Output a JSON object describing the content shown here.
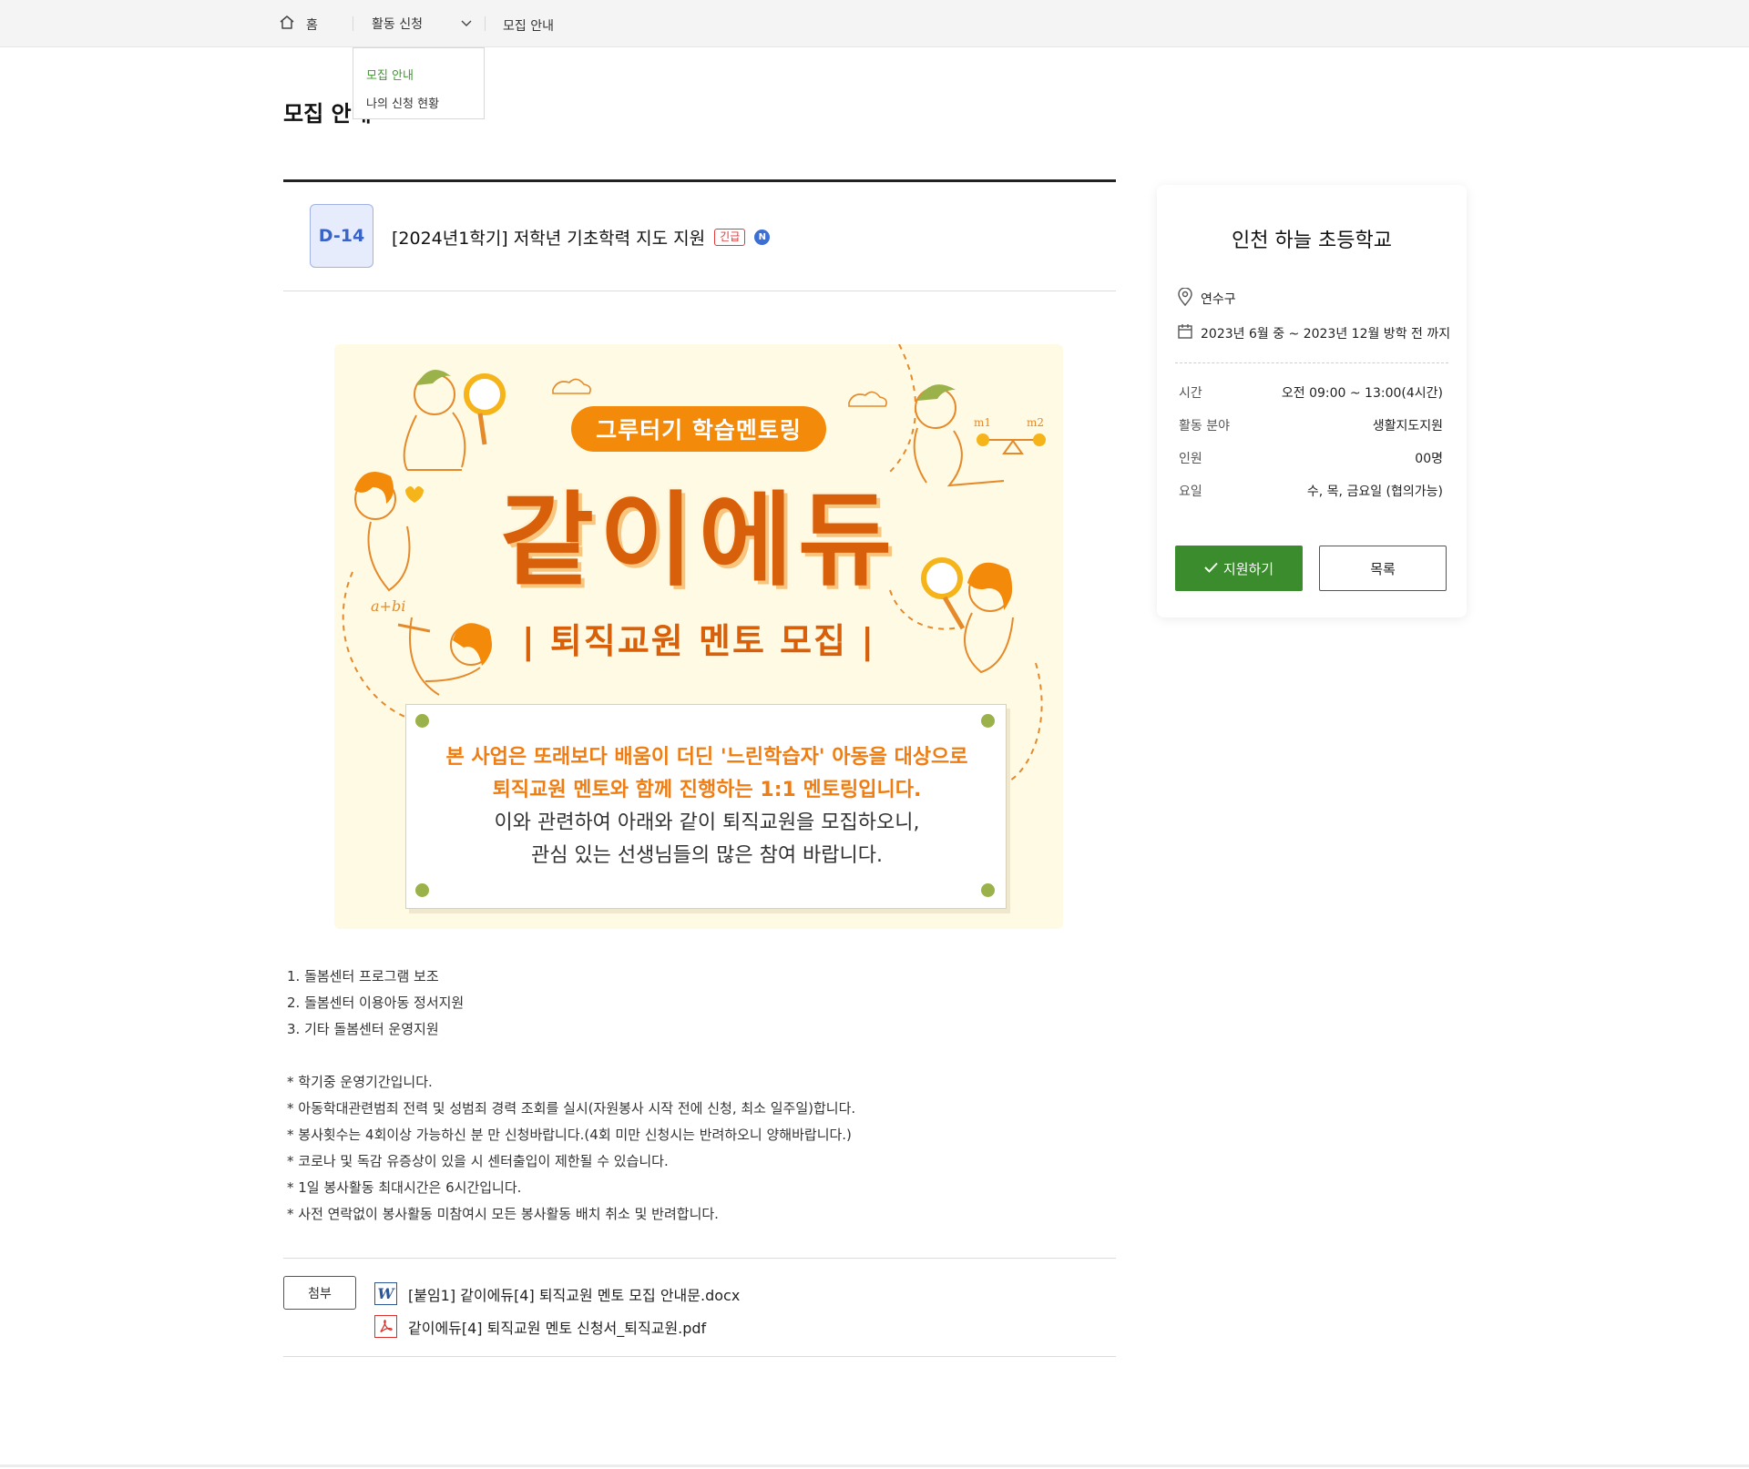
{
  "breadcrumb": {
    "home_label": "홈",
    "section_label": "활동 신청",
    "current_label": "모집 안내"
  },
  "dropdown": {
    "items": [
      "모집 안내",
      "나의 신청 현황"
    ]
  },
  "page_title": "모집 안내",
  "post": {
    "dday": "D-14",
    "title": "[2024년1학기] 저학년 기초학력 지도 지원",
    "urgent_tag": "긴급",
    "new_badge": "N"
  },
  "poster": {
    "pill": "그루터기 학습멘토링",
    "headline": "같이에듀",
    "subheadline": "| 퇴직교원 멘토 모집 |",
    "note_lines": [
      "본 사업은 또래보다 배움이 더딘 '느린학습자' 아동을 대상으로",
      "퇴직교원 멘토와 함께 진행하는 1:1 멘토링입니다.",
      "이와 관련하여 아래와 같이 퇴직교원을 모집하오니,",
      "관심 있는 선생님들의 많은 참여 바랍니다."
    ],
    "formula": "a+bi",
    "scale_labels": [
      "m1",
      "m2"
    ],
    "colors": {
      "orange": "#d9600b",
      "accent": "#f38a0a",
      "bg": "#fffae4",
      "dot": "#9ab249"
    }
  },
  "body_lines": [
    "1. 돌봄센터 프로그램 보조",
    "2. 돌봄센터 이용아동 정서지원",
    "3. 기타 돌봄센터 운영지원",
    "",
    "* 학기중 운영기간입니다.",
    "* 아동학대관련범죄 전력 및 성범죄 경력 조회를 실시(자원봉사 시작 전에 신청, 최소 일주일)합니다.",
    "* 봉사횟수는 4회이상 가능하신 분 만 신청바랍니다.(4회 미만 신청시는 반려하오니 양해바랍니다.)",
    "* 코로나 및 독감 유증상이 있을 시 센터출입이 제한될 수 있습니다.",
    "* 1일 봉사활동 최대시간은 6시간입니다.",
    "* 사전 연락없이 봉사활동 미참여시 모든 봉사활동 배치 취소 및 반려합니다."
  ],
  "attachments": {
    "label": "첨부",
    "files": [
      {
        "name": "[붙임1] 같이에듀[4] 퇴직교원 멘토 모집 안내문.docx",
        "icon": "word-icon"
      },
      {
        "name": "같이에듀[4] 퇴직교원 멘토 신청서_퇴직교원.pdf",
        "icon": "pdf-icon"
      }
    ]
  },
  "side": {
    "school": "인천 하늘 초등학교",
    "location": "연수구",
    "period": "2023년 6월 중 ~ 2023년 12월 방학 전 까지",
    "rows": [
      {
        "key": "시간",
        "value": "오전 09:00 ~ 13:00(4시간)"
      },
      {
        "key": "활동 분야",
        "value": "생활지도지원"
      },
      {
        "key": "인원",
        "value": "00명"
      },
      {
        "key": "요일",
        "value": "수, 목, 금요일 (협의가능)"
      }
    ],
    "apply_label": "지원하기",
    "list_label": "목록",
    "colors": {
      "apply": "#3a8c2c",
      "dday_bg": "#e6ecfb",
      "dday_text": "#3a63c9",
      "urgent": "#e23a3a"
    }
  }
}
